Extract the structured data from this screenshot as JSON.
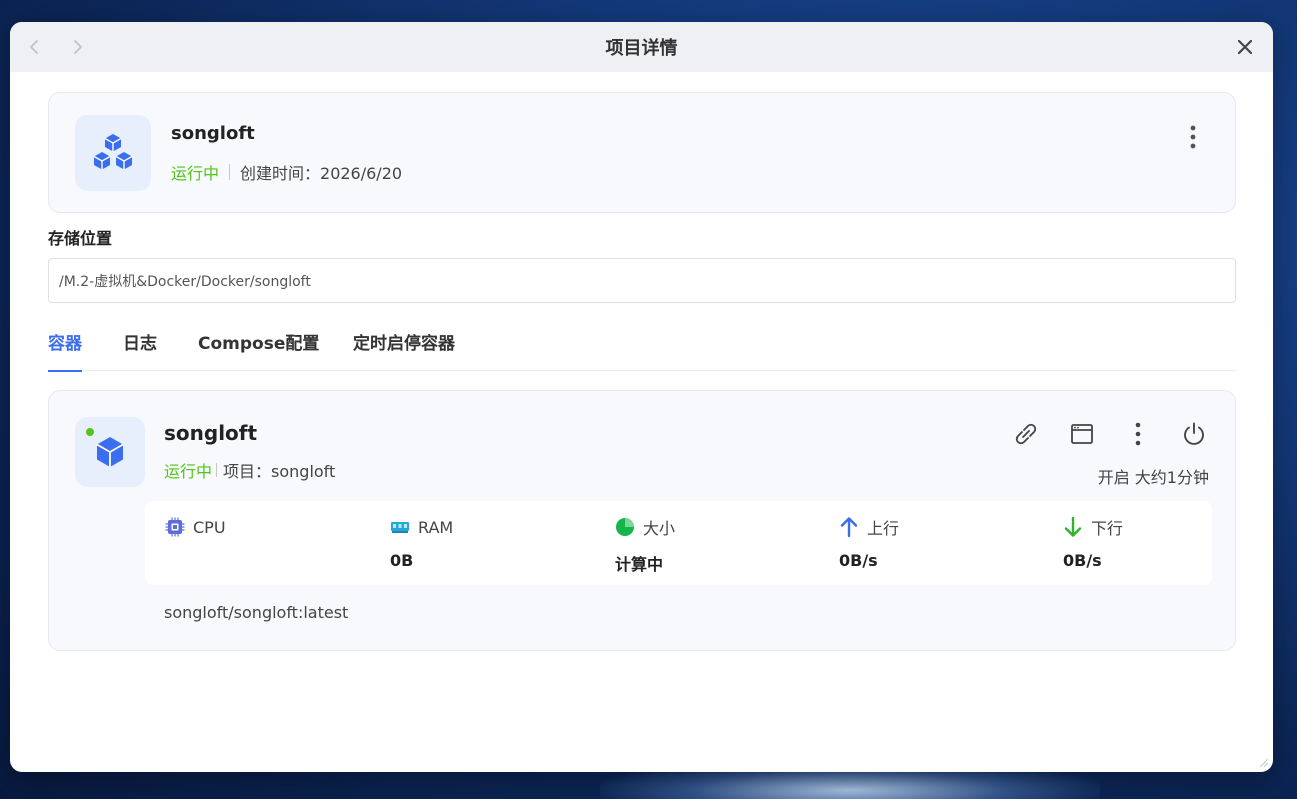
{
  "window": {
    "title": "项目详情"
  },
  "project": {
    "name": "songloft",
    "status": "运行中",
    "created": "创建时间：2026/6/20"
  },
  "storage": {
    "label": "存储位置",
    "path": "/M.2-虚拟机&Docker/Docker/songloft"
  },
  "tabs": [
    {
      "label": "容器",
      "active": true
    },
    {
      "label": "日志",
      "active": false
    },
    {
      "label": "Compose配置",
      "active": false
    },
    {
      "label": "定时启停容器",
      "active": false
    }
  ],
  "container": {
    "name": "songloft",
    "status": "运行中",
    "project": "项目：songloft",
    "uptime": "开启 大约1分钟",
    "image": "songloft/songloft:latest",
    "stats": {
      "cpu": {
        "label": "CPU",
        "value": ""
      },
      "ram": {
        "label": "RAM",
        "value": "0B"
      },
      "size": {
        "label": "大小",
        "value": "计算中"
      },
      "up": {
        "label": "上行",
        "value": "0B/s"
      },
      "down": {
        "label": "下行",
        "value": "0B/s"
      }
    }
  },
  "icons": {
    "back": "chevron-left-icon",
    "forward": "chevron-right-icon",
    "close": "close-icon",
    "more": "more-vertical-icon",
    "link": "link-icon",
    "browser": "browser-window-icon",
    "power": "power-icon"
  },
  "colors": {
    "accent": "#3a6df0",
    "running": "#52c41a",
    "card_bg": "#f7f9fd",
    "icon_bg": "#e7effd"
  }
}
